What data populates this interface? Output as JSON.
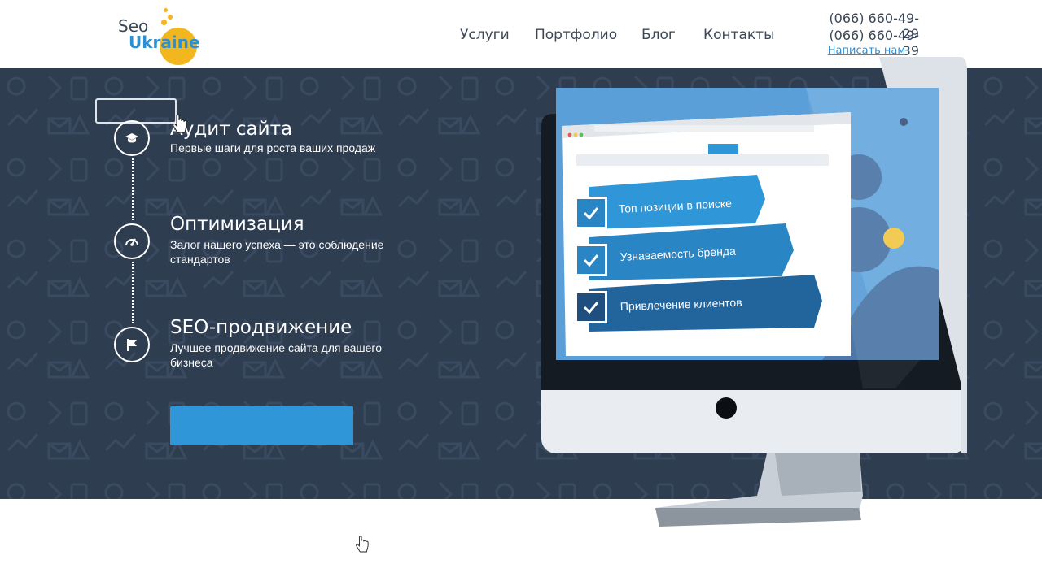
{
  "brand": {
    "logo_line1": "Seo",
    "logo_line2": "Ukraine"
  },
  "nav": [
    "Услуги",
    "Портфолио",
    "Блог",
    "Контакты"
  ],
  "contact": {
    "phone1": "(066) 660-49-29",
    "phone2": "(066) 660-49-39",
    "write_link": "Написать нам"
  },
  "features": [
    {
      "title": "Аудит сайта",
      "desc": "Первые шаги для роста ваших продаж",
      "icon": "graduation-cap-icon"
    },
    {
      "title": "Оптимизация",
      "desc": "Залог нашего успеха — это соблюдение стандартов",
      "icon": "speedometer-icon"
    },
    {
      "title": "SEO-продвижение",
      "desc": "Лучшее продвижение сайта для вашего бизнеса",
      "icon": "flag-icon"
    }
  ],
  "screen_items": [
    "Топ позиции в поиске",
    "Узнаваемость бренда",
    "Привлечение клиентов"
  ],
  "colors": {
    "hero_bg": "#2f3d51",
    "accent": "#2f97d8",
    "brand_yellow": "#f2b71f",
    "text_dark": "#3b4756"
  }
}
